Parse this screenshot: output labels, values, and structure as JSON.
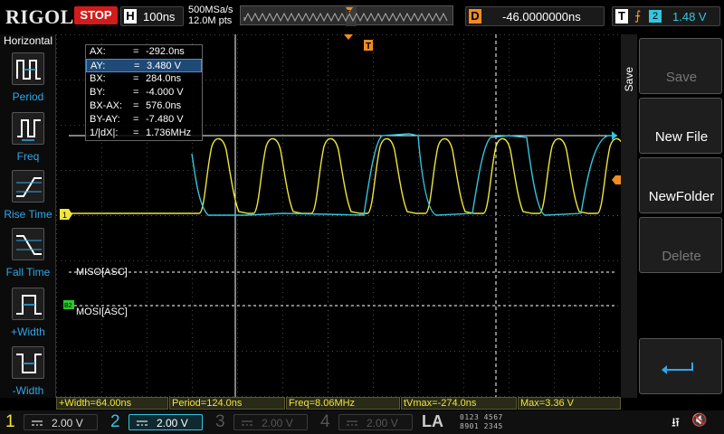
{
  "header": {
    "logo": "RIGOL",
    "run_state": "STOP",
    "horizontal": {
      "key": "H",
      "value": "100ns"
    },
    "sample_rate": "500MSa/s",
    "memory_depth": "12.0M pts",
    "delay": {
      "key": "D",
      "value": "-46.0000000ns"
    },
    "trigger": {
      "key": "T",
      "edge_icon": "rising-edge-icon",
      "source": "2",
      "level": "1.48 V"
    }
  },
  "left_menu": {
    "title": "Horizontal",
    "items": [
      {
        "label": "Period",
        "icon": "period-icon"
      },
      {
        "label": "Freq",
        "icon": "freq-icon"
      },
      {
        "label": "Rise Time",
        "icon": "rise-time-icon"
      },
      {
        "label": "Fall Time",
        "icon": "fall-time-icon"
      },
      {
        "label": "+Width",
        "icon": "pos-width-icon"
      },
      {
        "label": "-Width",
        "icon": "neg-width-icon"
      }
    ]
  },
  "cursor_readout": [
    {
      "label": "AX:",
      "value": "-292.0ns",
      "selected": false
    },
    {
      "label": "AY:",
      "value": "3.480 V",
      "selected": true
    },
    {
      "label": "BX:",
      "value": "284.0ns",
      "selected": false
    },
    {
      "label": "BY:",
      "value": "-4.000 V",
      "selected": false
    },
    {
      "label": "BX-AX:",
      "value": "576.0ns",
      "selected": false
    },
    {
      "label": "BY-AY:",
      "value": "-7.480 V",
      "selected": false
    },
    {
      "label": "1/|dX|:",
      "value": "1.736MHz",
      "selected": false
    }
  ],
  "decoders": [
    {
      "marker": "B1",
      "label": "MISO[ASC]"
    },
    {
      "marker": "B2",
      "label": "MOSI[ASC]"
    }
  ],
  "markers": {
    "ch1_level": "1",
    "ch2_level": "2",
    "trigger_pos": "T"
  },
  "save_menu": {
    "side_label": "Save",
    "buttons": [
      {
        "label": "Save",
        "enabled": false
      },
      {
        "label": "New File",
        "enabled": true
      },
      {
        "label": "NewFolder",
        "enabled": true
      },
      {
        "label": "Delete",
        "enabled": false
      },
      {
        "label": "",
        "icon": "return-arrow-icon",
        "enabled": true
      }
    ]
  },
  "measurements": [
    {
      "text": "+Width=64.00ns"
    },
    {
      "text": "Period=124.0ns"
    },
    {
      "text": "Freq=8.06MHz"
    },
    {
      "text": "tVmax=-274.0ns"
    },
    {
      "text": "Max=3.36 V"
    }
  ],
  "channels": [
    {
      "num": "1",
      "coupling": "DC",
      "scale": "2.00 V",
      "active": true,
      "color": "#f0e63c"
    },
    {
      "num": "2",
      "coupling": "DC",
      "scale": "2.00 V",
      "active": true,
      "color": "#33c6e0"
    },
    {
      "num": "3",
      "coupling": "DC",
      "scale": "2.00 V",
      "active": false,
      "color": "#b03cb0"
    },
    {
      "num": "4",
      "coupling": "DC",
      "scale": "2.00 V",
      "active": false,
      "color": "#3c6ad0"
    }
  ],
  "logic_analyzer": {
    "label": "LA",
    "bits_row1": "0123 4567",
    "bits_row2": "8901 2345"
  },
  "status_icons": {
    "usb": "usb-icon",
    "sound": "mute-icon"
  },
  "colors": {
    "ch1": "#f0e63c",
    "ch2": "#33c6e0",
    "trigger": "#f08c1e",
    "accent": "#2fa8e8",
    "stop": "#d21b1b"
  }
}
